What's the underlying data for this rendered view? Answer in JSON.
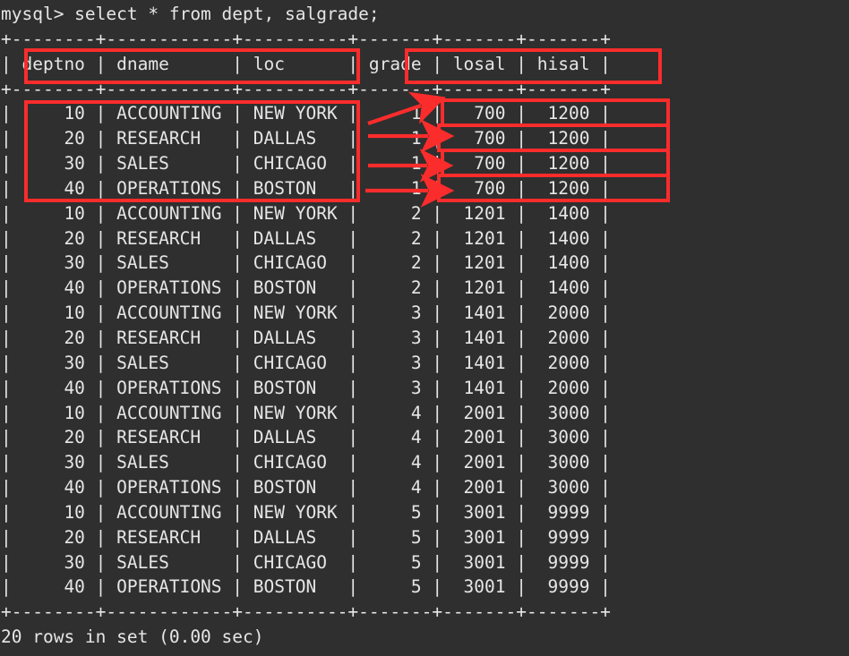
{
  "terminal": {
    "prompt_line": "mysql> select * from dept, salgrade;",
    "footer_line": "20 rows in set (0.00 sec)",
    "separator": "+--------+------------+----------+-------+-------+-------+",
    "colors": {
      "background": "#2f2f2f",
      "foreground": "#e6e6e6",
      "annotation": "#fb2c2c"
    }
  },
  "table": {
    "columns": [
      "deptno",
      "dname",
      "loc",
      "grade",
      "losal",
      "hisal"
    ],
    "header_row": "| deptno | dname      | loc      | grade | losal | hisal |",
    "row_count_label": "20 rows in set (0.00 sec)",
    "rows": [
      {
        "deptno": "10",
        "dname": "ACCOUNTING",
        "loc": "NEW YORK",
        "grade": "1",
        "losal": "700",
        "hisal": "1200"
      },
      {
        "deptno": "20",
        "dname": "RESEARCH",
        "loc": "DALLAS",
        "grade": "1",
        "losal": "700",
        "hisal": "1200"
      },
      {
        "deptno": "30",
        "dname": "SALES",
        "loc": "CHICAGO",
        "grade": "1",
        "losal": "700",
        "hisal": "1200"
      },
      {
        "deptno": "40",
        "dname": "OPERATIONS",
        "loc": "BOSTON",
        "grade": "1",
        "losal": "700",
        "hisal": "1200"
      },
      {
        "deptno": "10",
        "dname": "ACCOUNTING",
        "loc": "NEW YORK",
        "grade": "2",
        "losal": "1201",
        "hisal": "1400"
      },
      {
        "deptno": "20",
        "dname": "RESEARCH",
        "loc": "DALLAS",
        "grade": "2",
        "losal": "1201",
        "hisal": "1400"
      },
      {
        "deptno": "30",
        "dname": "SALES",
        "loc": "CHICAGO",
        "grade": "2",
        "losal": "1201",
        "hisal": "1400"
      },
      {
        "deptno": "40",
        "dname": "OPERATIONS",
        "loc": "BOSTON",
        "grade": "2",
        "losal": "1201",
        "hisal": "1400"
      },
      {
        "deptno": "10",
        "dname": "ACCOUNTING",
        "loc": "NEW YORK",
        "grade": "3",
        "losal": "1401",
        "hisal": "2000"
      },
      {
        "deptno": "20",
        "dname": "RESEARCH",
        "loc": "DALLAS",
        "grade": "3",
        "losal": "1401",
        "hisal": "2000"
      },
      {
        "deptno": "30",
        "dname": "SALES",
        "loc": "CHICAGO",
        "grade": "3",
        "losal": "1401",
        "hisal": "2000"
      },
      {
        "deptno": "40",
        "dname": "OPERATIONS",
        "loc": "BOSTON",
        "grade": "3",
        "losal": "1401",
        "hisal": "2000"
      },
      {
        "deptno": "10",
        "dname": "ACCOUNTING",
        "loc": "NEW YORK",
        "grade": "4",
        "losal": "2001",
        "hisal": "3000"
      },
      {
        "deptno": "20",
        "dname": "RESEARCH",
        "loc": "DALLAS",
        "grade": "4",
        "losal": "2001",
        "hisal": "3000"
      },
      {
        "deptno": "30",
        "dname": "SALES",
        "loc": "CHICAGO",
        "grade": "4",
        "losal": "2001",
        "hisal": "3000"
      },
      {
        "deptno": "40",
        "dname": "OPERATIONS",
        "loc": "BOSTON",
        "grade": "4",
        "losal": "2001",
        "hisal": "3000"
      },
      {
        "deptno": "10",
        "dname": "ACCOUNTING",
        "loc": "NEW YORK",
        "grade": "5",
        "losal": "3001",
        "hisal": "9999"
      },
      {
        "deptno": "20",
        "dname": "RESEARCH",
        "loc": "DALLAS",
        "grade": "5",
        "losal": "3001",
        "hisal": "9999"
      },
      {
        "deptno": "30",
        "dname": "SALES",
        "loc": "CHICAGO",
        "grade": "5",
        "losal": "3001",
        "hisal": "9999"
      },
      {
        "deptno": "40",
        "dname": "OPERATIONS",
        "loc": "BOSTON",
        "grade": "5",
        "losal": "3001",
        "hisal": "9999"
      }
    ]
  },
  "annotations": {
    "description": "Red boxes highlight the dept table columns and the first salgrade row repeated for each dept row; arrows show the cartesian-product pairing.",
    "arrow_count": 4,
    "left_header_box": "deptno | dname | loc",
    "right_header_box": "grade | losal | hisal",
    "left_data_box": "first four dept rows",
    "right_data_boxes": "four grade-1 salgrade rows"
  },
  "screen_text": "mysql> select * from dept, salgrade;\n+--------+------------+----------+-------+-------+-------+\n| deptno | dname      | loc      | grade | losal | hisal |\n+--------+------------+----------+-------+-------+-------+\n|     10 | ACCOUNTING | NEW YORK |     1 |   700 |  1200 |\n|     20 | RESEARCH   | DALLAS   |     1 |   700 |  1200 |\n|     30 | SALES      | CHICAGO  |     1 |   700 |  1200 |\n|     40 | OPERATIONS | BOSTON   |     1 |   700 |  1200 |\n|     10 | ACCOUNTING | NEW YORK |     2 |  1201 |  1400 |\n|     20 | RESEARCH   | DALLAS   |     2 |  1201 |  1400 |\n|     30 | SALES      | CHICAGO  |     2 |  1201 |  1400 |\n|     40 | OPERATIONS | BOSTON   |     2 |  1201 |  1400 |\n|     10 | ACCOUNTING | NEW YORK |     3 |  1401 |  2000 |\n|     20 | RESEARCH   | DALLAS   |     3 |  1401 |  2000 |\n|     30 | SALES      | CHICAGO  |     3 |  1401 |  2000 |\n|     40 | OPERATIONS | BOSTON   |     3 |  1401 |  2000 |\n|     10 | ACCOUNTING | NEW YORK |     4 |  2001 |  3000 |\n|     20 | RESEARCH   | DALLAS   |     4 |  2001 |  3000 |\n|     30 | SALES      | CHICAGO  |     4 |  2001 |  3000 |\n|     40 | OPERATIONS | BOSTON   |     4 |  2001 |  3000 |\n|     10 | ACCOUNTING | NEW YORK |     5 |  3001 |  9999 |\n|     20 | RESEARCH   | DALLAS   |     5 |  3001 |  9999 |\n|     30 | SALES      | CHICAGO  |     5 |  3001 |  9999 |\n|     40 | OPERATIONS | BOSTON   |     5 |  3001 |  9999 |\n+--------+------------+----------+-------+-------+-------+\n20 rows in set (0.00 sec)"
}
